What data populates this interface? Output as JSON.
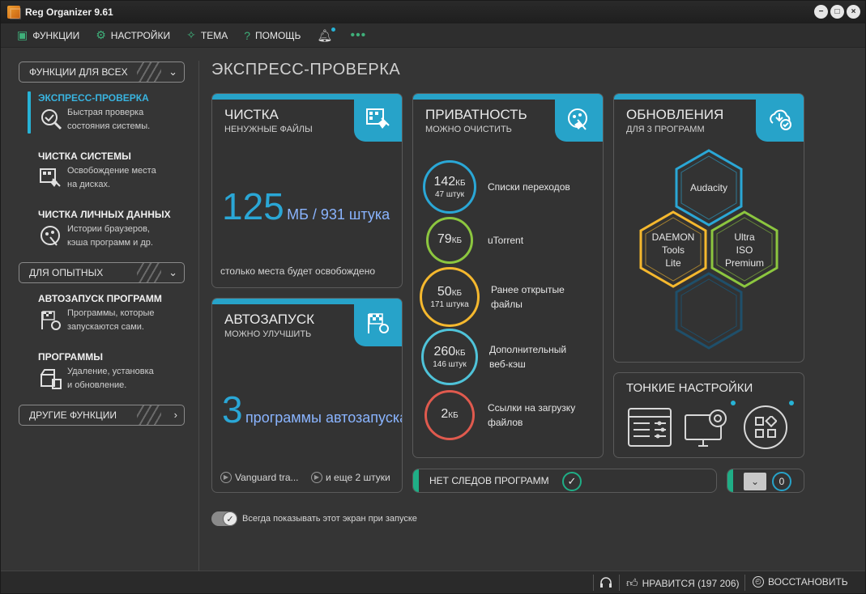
{
  "window": {
    "title": "Reg Organizer 9.61",
    "controls": [
      "minimize",
      "maximize",
      "close"
    ]
  },
  "menu": {
    "items": [
      {
        "label": "ФУНКЦИИ",
        "icon": "briefcase-icon"
      },
      {
        "label": "НАСТРОЙКИ",
        "icon": "gear-icon"
      },
      {
        "label": "ТЕМА",
        "icon": "bulb-icon"
      },
      {
        "label": "ПОМОЩЬ",
        "icon": "question-icon"
      }
    ],
    "bell_icon": "bell-icon",
    "more": "•••"
  },
  "sidebar": {
    "sections": [
      {
        "label": "ФУНКЦИИ ДЛЯ ВСЕХ"
      },
      {
        "label": "ДЛЯ ОПЫТНЫХ"
      },
      {
        "label": "ДРУГИЕ ФУНКЦИИ"
      }
    ],
    "items": [
      {
        "title": "ЭКСПРЕСС-ПРОВЕРКА",
        "desc1": "Быстрая проверка",
        "desc2": "состояния системы."
      },
      {
        "title": "ЧИСТКА СИСТЕМЫ",
        "desc1": "Освобождение места",
        "desc2": "на дисках."
      },
      {
        "title": "ЧИСТКА ЛИЧНЫХ ДАННЫХ",
        "desc1": "Истории браузеров,",
        "desc2": "кэша программ и др."
      },
      {
        "title": "АВТОЗАПУСК ПРОГРАММ",
        "desc1": "Программы, которые",
        "desc2": "запускаются сами."
      },
      {
        "title": "ПРОГРАММЫ",
        "desc1": "Удаление, установка",
        "desc2": "и обновление."
      }
    ]
  },
  "main": {
    "title": "ЭКСПРЕСС-ПРОВЕРКА",
    "cleanup": {
      "title": "ЧИСТКА",
      "subtitle": "НЕНУЖНЫЕ ФАЙЛЫ",
      "big_value": "125",
      "big_unit": "МБ / 931 штука",
      "note": "столько места будет освобождено"
    },
    "autorun": {
      "title": "АВТОЗАПУСК",
      "subtitle": "МОЖНО УЛУЧШИТЬ",
      "big_value": "3",
      "big_unit": "программы автозапуска",
      "item1": "Vanguard tra...",
      "item2": "и еще 2 штуки"
    },
    "privacy": {
      "title": "ПРИВАТНОСТЬ",
      "subtitle": "МОЖНО ОЧИСТИТЬ",
      "items": [
        {
          "value": "142",
          "unit": "КБ",
          "count": "47 штук",
          "label1": "Списки переходов",
          "label2": "",
          "color": "#2aa7d6"
        },
        {
          "value": "79",
          "unit": "КБ",
          "count": "",
          "label1": "uTorrent",
          "label2": "",
          "color": "#8cc63f"
        },
        {
          "value": "50",
          "unit": "КБ",
          "count": "171 штука",
          "label1": "Ранее открытые",
          "label2": "файлы",
          "color": "#f5b82e"
        },
        {
          "value": "260",
          "unit": "КБ",
          "count": "146 штук",
          "label1": "Дополнительный",
          "label2": "веб-кэш",
          "color": "#4fc3d9"
        },
        {
          "value": "2",
          "unit": "КБ",
          "count": "",
          "label1": "Ссылки на загрузку",
          "label2": "файлов",
          "color": "#e05a4e"
        }
      ]
    },
    "updates": {
      "title": "ОБНОВЛЕНИЯ",
      "subtitle": "ДЛЯ 3 ПРОГРАММ",
      "apps": [
        {
          "name": "Audacity",
          "color": "#2aa7d6"
        },
        {
          "name1": "DAEMON",
          "name2": "Tools",
          "name3": "Lite",
          "color": "#f5b82e"
        },
        {
          "name1": "Ultra",
          "name2": "ISO",
          "name3": "Premium",
          "color": "#8cc63f"
        }
      ]
    },
    "tweaks": {
      "title": "ТОНКИЕ НАСТРОЙКИ"
    },
    "traces": {
      "label": "НЕТ СЛЕДОВ ПРОГРАММ"
    },
    "drivers": {
      "count": "0"
    },
    "show_on_start": "Всегда показывать этот экран при запуске"
  },
  "statusbar": {
    "likes": "НРАВИТСЯ (197 206)",
    "restore": "ВОССТАНОВИТЬ"
  }
}
